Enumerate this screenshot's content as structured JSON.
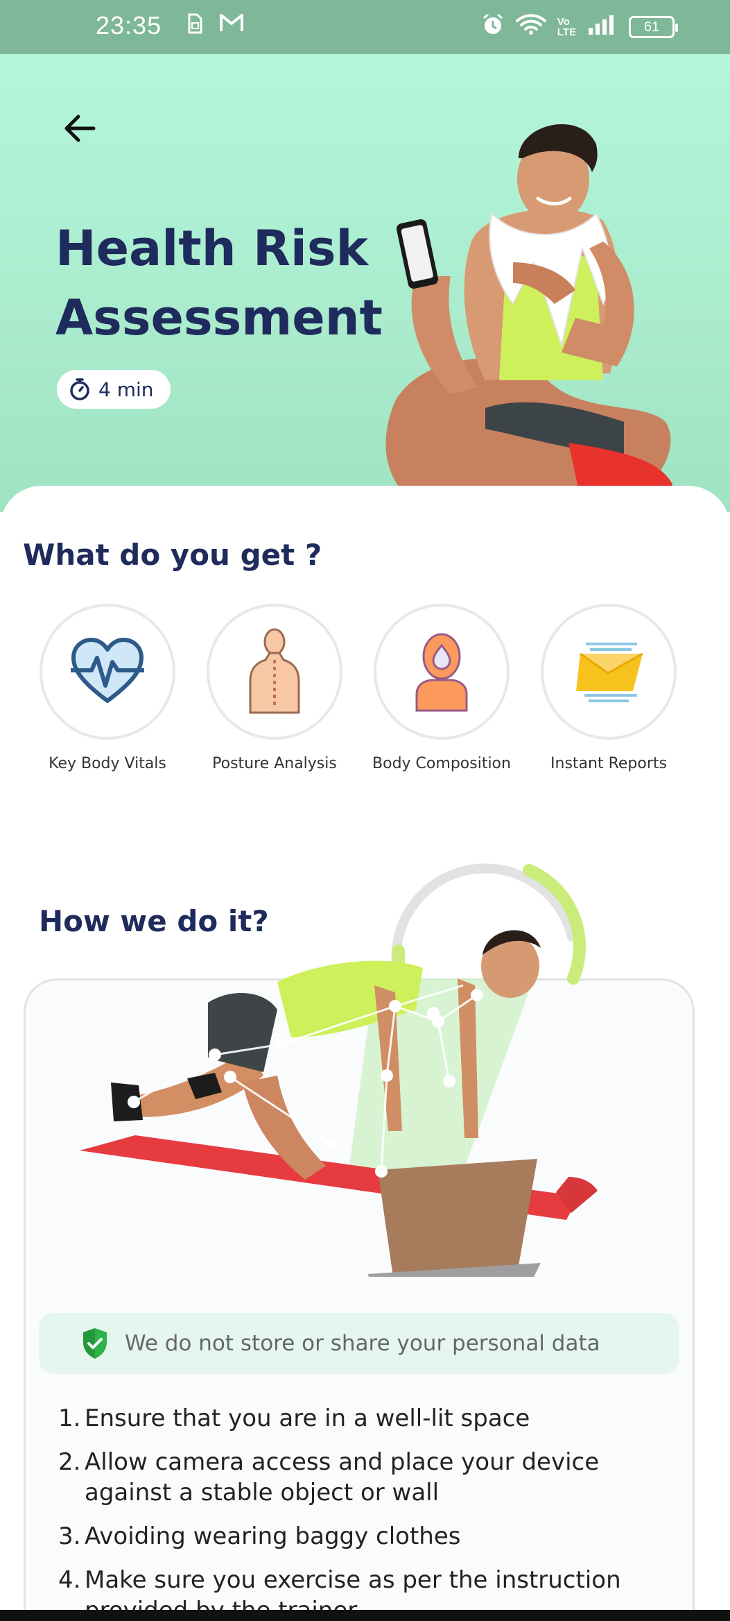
{
  "status_bar": {
    "time": "23:35",
    "left_icons": [
      "sim-icon",
      "gmail-icon"
    ],
    "right_icons": [
      "alarm-icon",
      "wifi-icon",
      "volte-icon",
      "signal-icon"
    ],
    "volte_text": "Vo\nLTE",
    "battery": "61"
  },
  "hero": {
    "title": "Health Risk Assessment",
    "duration": "4 min",
    "duration_icon": "stopwatch-icon",
    "back_icon": "arrow-left-icon"
  },
  "features": {
    "title": "What do you get ?",
    "items": [
      {
        "label": "Key Body Vitals",
        "icon": "heart-pulse-icon"
      },
      {
        "label": "Posture Analysis",
        "icon": "spine-back-icon"
      },
      {
        "label": "Body Composition",
        "icon": "body-composition-icon"
      },
      {
        "label": "Instant Reports",
        "icon": "report-envelope-icon"
      }
    ]
  },
  "how": {
    "title": "How we do it?",
    "privacy_text": "We do not store or share your personal data",
    "privacy_icon": "shield-check-icon",
    "steps": [
      "Ensure that you are in a well-lit space",
      "Allow camera access and place your device against a stable object or wall",
      "Avoiding wearing baggy clothes",
      "Make sure you exercise as per the instruction provided by the trainer"
    ]
  },
  "colors": {
    "hero_bg": "#b4f6dc",
    "title": "#1e2b5c",
    "privacy_bg": "#e5f6ef",
    "shield": "#2db34a",
    "accent_lime": "#c9ec7a"
  }
}
